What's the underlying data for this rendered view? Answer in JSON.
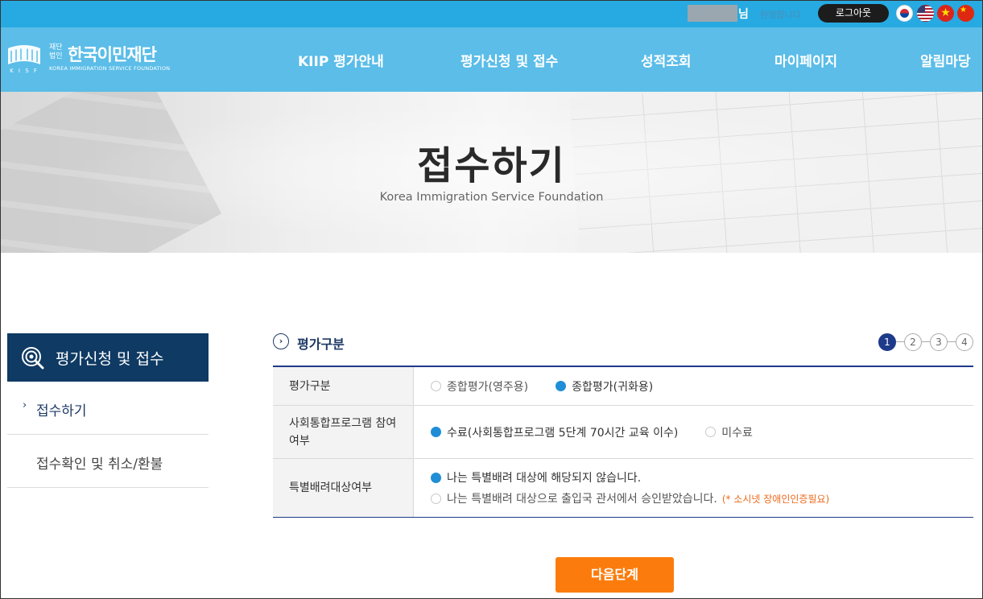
{
  "topbar": {
    "honorific": "님",
    "welcome": "환영합니다",
    "logout_label": "로그아웃",
    "languages": [
      "korean-flag-icon",
      "us-flag-icon",
      "vietnam-flag-icon",
      "china-flag-icon"
    ]
  },
  "brand": {
    "foundation_type_top": "재단",
    "foundation_type_bottom": "법인",
    "name": "한국이민재단",
    "english_name": "KOREA IMMIGRATION SERVICE FOUNDATION",
    "mark_text": "K I S F",
    "color_header": "#5bbde8",
    "color_topbar": "#27a9e1"
  },
  "nav": {
    "items": [
      "KIIP 평가안내",
      "평가신청 및 접수",
      "성적조회",
      "마이페이지",
      "알림마당"
    ]
  },
  "hero": {
    "title": "접수하기",
    "subtitle": "Korea Immigration Service Foundation"
  },
  "sidebar": {
    "header": "평가신청 및 접수",
    "items": [
      {
        "label": "접수하기",
        "active": true
      },
      {
        "label": "접수확인 및 취소/환불",
        "active": false
      }
    ]
  },
  "section": {
    "title": "평가구분",
    "steps": [
      "1",
      "2",
      "3",
      "4"
    ],
    "current_step": "1"
  },
  "form": {
    "rows": [
      {
        "label": "평가구분",
        "options": [
          {
            "text": "종합평가(영주용)",
            "selected": false
          },
          {
            "text": "종합평가(귀화용)",
            "selected": true
          }
        ]
      },
      {
        "label": "사회통합프로그램 참여여부",
        "options": [
          {
            "text": "수료(사회통합프로그램 5단계 70시간 교육 이수)",
            "selected": true
          },
          {
            "text": "미수료",
            "selected": false
          }
        ]
      },
      {
        "label": "특별배려대상여부",
        "options": [
          {
            "text": "나는 특별배려 대상에 해당되지 않습니다.",
            "selected": true
          },
          {
            "text": "나는 특별배려 대상으로 출입국 관서에서 승인받았습니다.",
            "selected": false
          }
        ],
        "note": "(* 소시넷 장애인인증필요)"
      }
    ]
  },
  "actions": {
    "next_label": "다음단계",
    "accent": "#fb7c0c"
  }
}
